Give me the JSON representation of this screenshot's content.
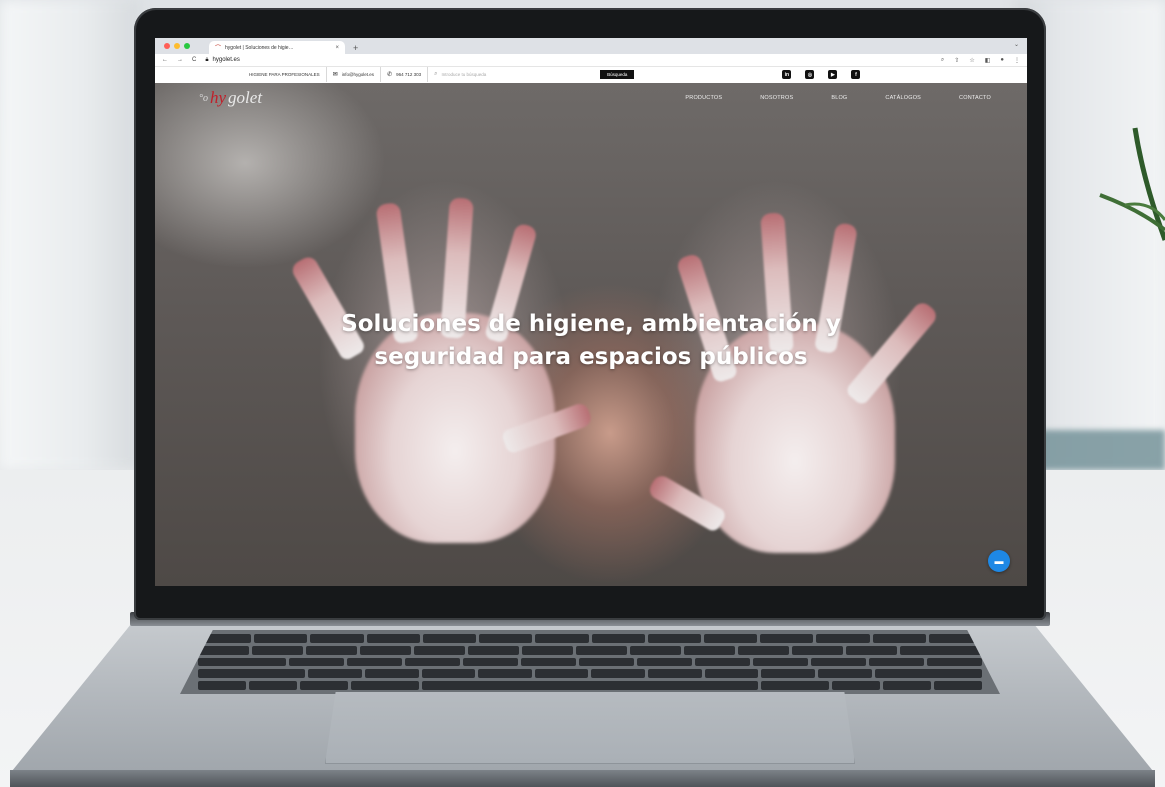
{
  "browser": {
    "tab_title": "hygolet | Soluciones de higie…",
    "tab_close": "×",
    "new_tab": "+",
    "url": "hygolet.es",
    "dot_colors": [
      "#ff5f57",
      "#febc2e",
      "#28c840"
    ]
  },
  "topbar": {
    "tagline": "HIGIENE PARA PROFESIONALES",
    "email": "info@hygolet.es",
    "phone": "964 712 303",
    "search_placeholder": "Introduce tu búsqueda",
    "search_button": "Búsqueda",
    "social": [
      "in",
      "◎",
      "▶",
      "f"
    ]
  },
  "site": {
    "logo_hy": "hy",
    "logo_rest": "golet",
    "menu": [
      "PRODUCTOS",
      "NOSOTROS",
      "BLOG",
      "CATÁLOGOS",
      "CONTACTO"
    ],
    "headline_line1": "Soluciones de higiene, ambientación y",
    "headline_line2": "seguridad para espacios públicos"
  },
  "icons": {
    "chat": "chat-bubble-icon",
    "accent": "#1e88e5",
    "brand_red": "#c0202a"
  }
}
